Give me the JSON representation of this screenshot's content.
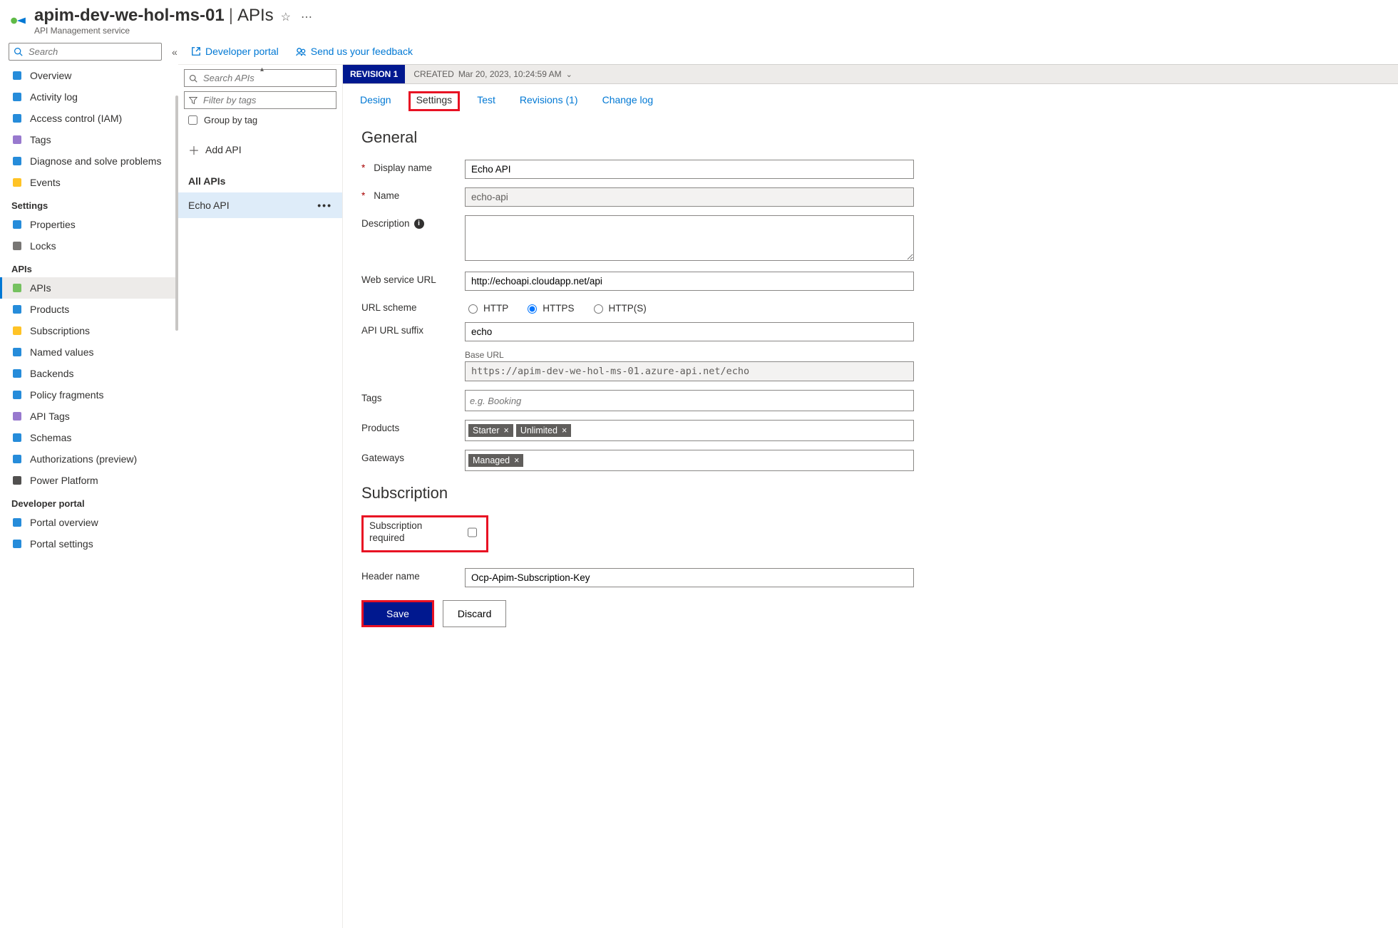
{
  "header": {
    "resource_name": "apim-dev-we-hol-ms-01",
    "section": "APIs",
    "subtitle": "API Management service"
  },
  "leftnav": {
    "search_placeholder": "Search",
    "items_top": [
      {
        "label": "Overview",
        "icon": "globe"
      },
      {
        "label": "Activity log",
        "icon": "log"
      },
      {
        "label": "Access control (IAM)",
        "icon": "people"
      },
      {
        "label": "Tags",
        "icon": "tag"
      },
      {
        "label": "Diagnose and solve problems",
        "icon": "wrench"
      },
      {
        "label": "Events",
        "icon": "bolt"
      }
    ],
    "section_settings": "Settings",
    "items_settings": [
      {
        "label": "Properties",
        "icon": "props"
      },
      {
        "label": "Locks",
        "icon": "lock"
      }
    ],
    "section_apis": "APIs",
    "items_apis": [
      {
        "label": "APIs",
        "icon": "api",
        "selected": true
      },
      {
        "label": "Products",
        "icon": "box"
      },
      {
        "label": "Subscriptions",
        "icon": "key"
      },
      {
        "label": "Named values",
        "icon": "grid"
      },
      {
        "label": "Backends",
        "icon": "cloud"
      },
      {
        "label": "Policy fragments",
        "icon": "policy"
      },
      {
        "label": "API Tags",
        "icon": "tag"
      },
      {
        "label": "Schemas",
        "icon": "schema"
      },
      {
        "label": "Authorizations (preview)",
        "icon": "auth"
      },
      {
        "label": "Power Platform",
        "icon": "power"
      }
    ],
    "section_devportal": "Developer portal",
    "items_devportal": [
      {
        "label": "Portal overview",
        "icon": "portal"
      },
      {
        "label": "Portal settings",
        "icon": "psettings"
      }
    ]
  },
  "toolbar": {
    "dev_portal": "Developer portal",
    "feedback": "Send us your feedback"
  },
  "api_list": {
    "search_placeholder": "Search APIs",
    "filter_placeholder": "Filter by tags",
    "group_by_tag": "Group by tag",
    "add_api": "Add API",
    "all_apis": "All APIs",
    "selected_api": "Echo API"
  },
  "revision": {
    "badge": "REVISION 1",
    "created_label": "CREATED",
    "created_value": "Mar 20, 2023, 10:24:59 AM"
  },
  "tabs": {
    "design": "Design",
    "settings": "Settings",
    "test": "Test",
    "revisions": "Revisions (1)",
    "changelog": "Change log"
  },
  "form": {
    "section_general": "General",
    "display_name_label": "Display name",
    "display_name": "Echo API",
    "name_label": "Name",
    "name": "echo-api",
    "description_label": "Description",
    "description": "",
    "web_url_label": "Web service URL",
    "web_url": "http://echoapi.cloudapp.net/api",
    "url_scheme_label": "URL scheme",
    "scheme_http": "HTTP",
    "scheme_https": "HTTPS",
    "scheme_both": "HTTP(S)",
    "suffix_label": "API URL suffix",
    "suffix": "echo",
    "base_url_label": "Base URL",
    "base_url": "https://apim-dev-we-hol-ms-01.azure-api.net/echo",
    "tags_label": "Tags",
    "tags_placeholder": "e.g. Booking",
    "products_label": "Products",
    "products": [
      "Starter",
      "Unlimited"
    ],
    "gateways_label": "Gateways",
    "gateways": [
      "Managed"
    ],
    "section_subscription": "Subscription",
    "sub_required_label": "Subscription required",
    "header_name_label": "Header name",
    "header_name": "Ocp-Apim-Subscription-Key",
    "save": "Save",
    "discard": "Discard"
  }
}
